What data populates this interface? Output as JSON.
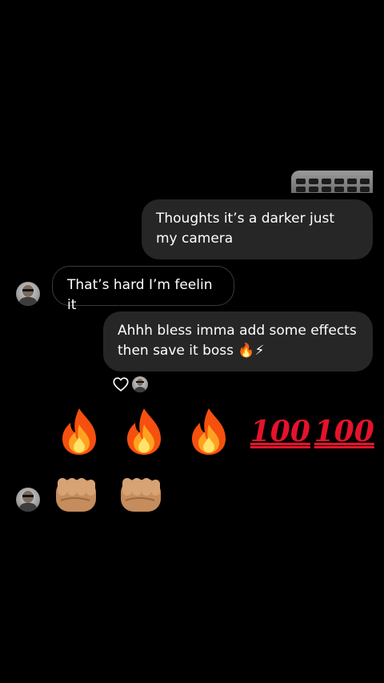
{
  "messages": [
    {
      "from": "me",
      "text": "Thoughts it’s a darker just my camera"
    },
    {
      "from": "them",
      "text": "That’s hard I’m feelin it"
    },
    {
      "from": "me",
      "text": "Ahhh bless imma add some effects then save it boss 🔥⚡"
    }
  ],
  "reaction": {
    "icon": "heart-icon"
  },
  "emoji_rows": {
    "row1": [
      "fire",
      "fire",
      "fire",
      "100",
      "100"
    ],
    "row1_hundred_text": "100",
    "row2": [
      "fist",
      "fist"
    ]
  },
  "colors": {
    "background": "#000000",
    "sent_bubble": "#262626",
    "received_border": "#3a3a3a",
    "hundred_red": "#e4132b"
  }
}
